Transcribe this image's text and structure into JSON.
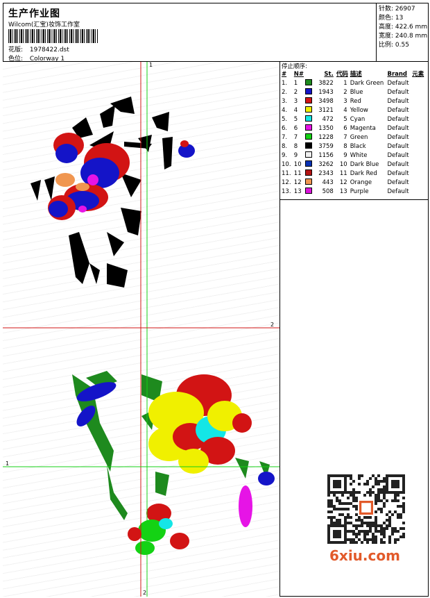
{
  "header": {
    "title": "生产作业图",
    "studio": "Wilcom(汇宝)妆饰工作室",
    "design_label": "花版:",
    "design_value": "1978422.dst",
    "colorway_label": "色位:",
    "colorway_value": "Colorway 1"
  },
  "stats": {
    "stitches_label": "针数:",
    "stitches_value": "26907",
    "colors_label": "颜色:",
    "colors_value": "13",
    "height_label": "高度:",
    "height_value": "422.6 mm",
    "width_label": "宽度:",
    "width_value": "240.8 mm",
    "scale_label": "比例:",
    "scale_value": "0.55"
  },
  "sequence": {
    "caption": "停止顺序:",
    "headers": [
      "#",
      "N#",
      "St.",
      "代码",
      "描述",
      "Brand",
      "元素"
    ],
    "rows": [
      {
        "n": "1.",
        "nn": "1",
        "color": "#1e8a1e",
        "st": "3822",
        "code": "1",
        "desc": "Dark Green",
        "brand": "Default"
      },
      {
        "n": "2.",
        "nn": "2",
        "color": "#1414c8",
        "st": "1943",
        "code": "2",
        "desc": "Blue",
        "brand": "Default"
      },
      {
        "n": "3.",
        "nn": "3",
        "color": "#d21414",
        "st": "3498",
        "code": "3",
        "desc": "Red",
        "brand": "Default"
      },
      {
        "n": "4.",
        "nn": "4",
        "color": "#f0f000",
        "st": "3121",
        "code": "4",
        "desc": "Yellow",
        "brand": "Default"
      },
      {
        "n": "5.",
        "nn": "5",
        "color": "#14e6e6",
        "st": "472",
        "code": "5",
        "desc": "Cyan",
        "brand": "Default"
      },
      {
        "n": "6.",
        "nn": "6",
        "color": "#e614e6",
        "st": "1350",
        "code": "6",
        "desc": "Magenta",
        "brand": "Default"
      },
      {
        "n": "7.",
        "nn": "7",
        "color": "#14d214",
        "st": "1228",
        "code": "7",
        "desc": "Green",
        "brand": "Default"
      },
      {
        "n": "8.",
        "nn": "8",
        "color": "#000000",
        "st": "3759",
        "code": "8",
        "desc": "Black",
        "brand": "Default"
      },
      {
        "n": "9.",
        "nn": "9",
        "color": "#f0f0f0",
        "st": "1156",
        "code": "9",
        "desc": "White",
        "brand": "Default"
      },
      {
        "n": "10.",
        "nn": "10",
        "color": "#0a32b4",
        "st": "3262",
        "code": "10",
        "desc": "Dark Blue",
        "brand": "Default"
      },
      {
        "n": "11.",
        "nn": "11",
        "color": "#b41414",
        "st": "2343",
        "code": "11",
        "desc": "Dark Red",
        "brand": "Default"
      },
      {
        "n": "12.",
        "nn": "12",
        "color": "#f09650",
        "st": "443",
        "code": "12",
        "desc": "Orange",
        "brand": "Default"
      },
      {
        "n": "13.",
        "nn": "13",
        "color": "#dc14dc",
        "st": "508",
        "code": "13",
        "desc": "Purple",
        "brand": "Default"
      }
    ]
  },
  "axes": {
    "v_red": "2",
    "v_green": "1",
    "h_red": "2",
    "h_green": "1",
    "bottom_red": "2"
  },
  "watermark": "6xiu.com"
}
